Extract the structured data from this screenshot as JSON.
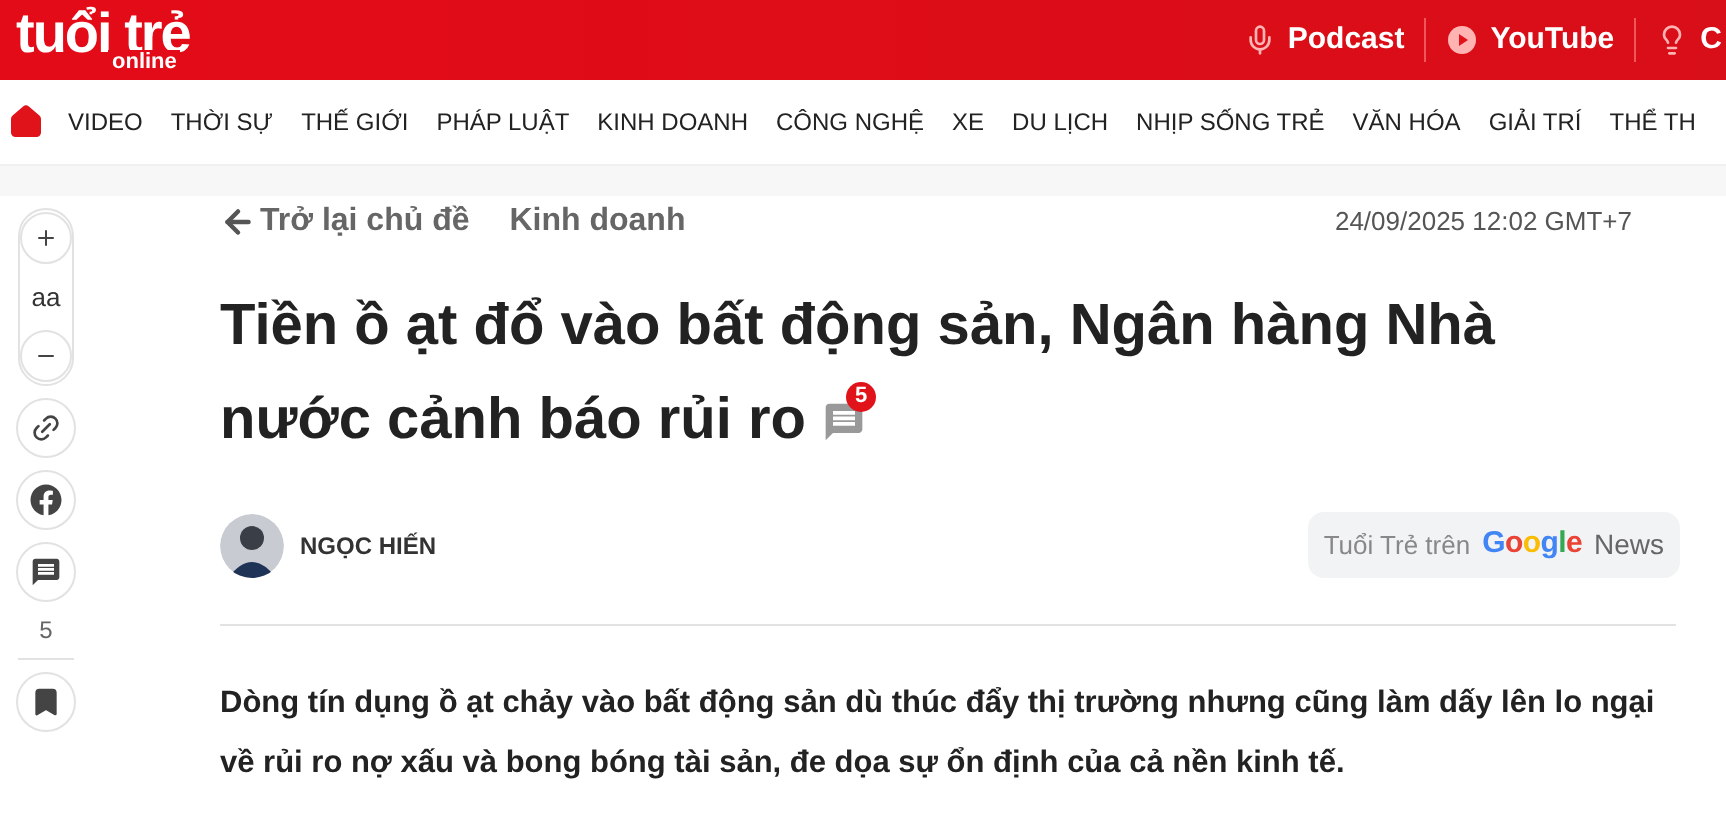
{
  "header": {
    "logo": {
      "main": "tuổi trẻ",
      "sub": "online"
    },
    "links": [
      {
        "kind": "podcast",
        "label": "Podcast"
      },
      {
        "kind": "youtube",
        "label": "YouTube"
      },
      {
        "kind": "bulb",
        "label": "C"
      }
    ]
  },
  "nav": {
    "items": [
      "VIDEO",
      "THỜI SỰ",
      "THẾ GIỚI",
      "PHÁP LUẬT",
      "KINH DOANH",
      "CÔNG NGHỆ",
      "XE",
      "DU LỊCH",
      "NHỊP SỐNG TRẺ",
      "VĂN HÓA",
      "GIẢI TRÍ",
      "THỂ TH"
    ]
  },
  "toolbar": {
    "font_size": "aa",
    "comment_count": "5"
  },
  "article": {
    "back_link": "Trở lại chủ đề",
    "category": "Kinh doanh",
    "date": "24/09/2025 12:02 GMT+7",
    "title": "Tiền ồ ạt đổ vào bất động sản, Ngân hàng Nhà nước cảnh báo rủi ro",
    "comment_badge": "5",
    "author": "NGỌC HIẾN",
    "google_news": {
      "prefix": "Tuổi Trẻ trên",
      "brand": "Google",
      "suffix": "News"
    },
    "summary": "Dòng tín dụng ồ ạt chảy vào bất động sản dù thúc đẩy thị trường nhưng cũng làm dấy lên lo ngại về rủi ro nợ xấu và bong bóng tài sản, đe dọa sự ổn định của cả nền kinh tế."
  }
}
